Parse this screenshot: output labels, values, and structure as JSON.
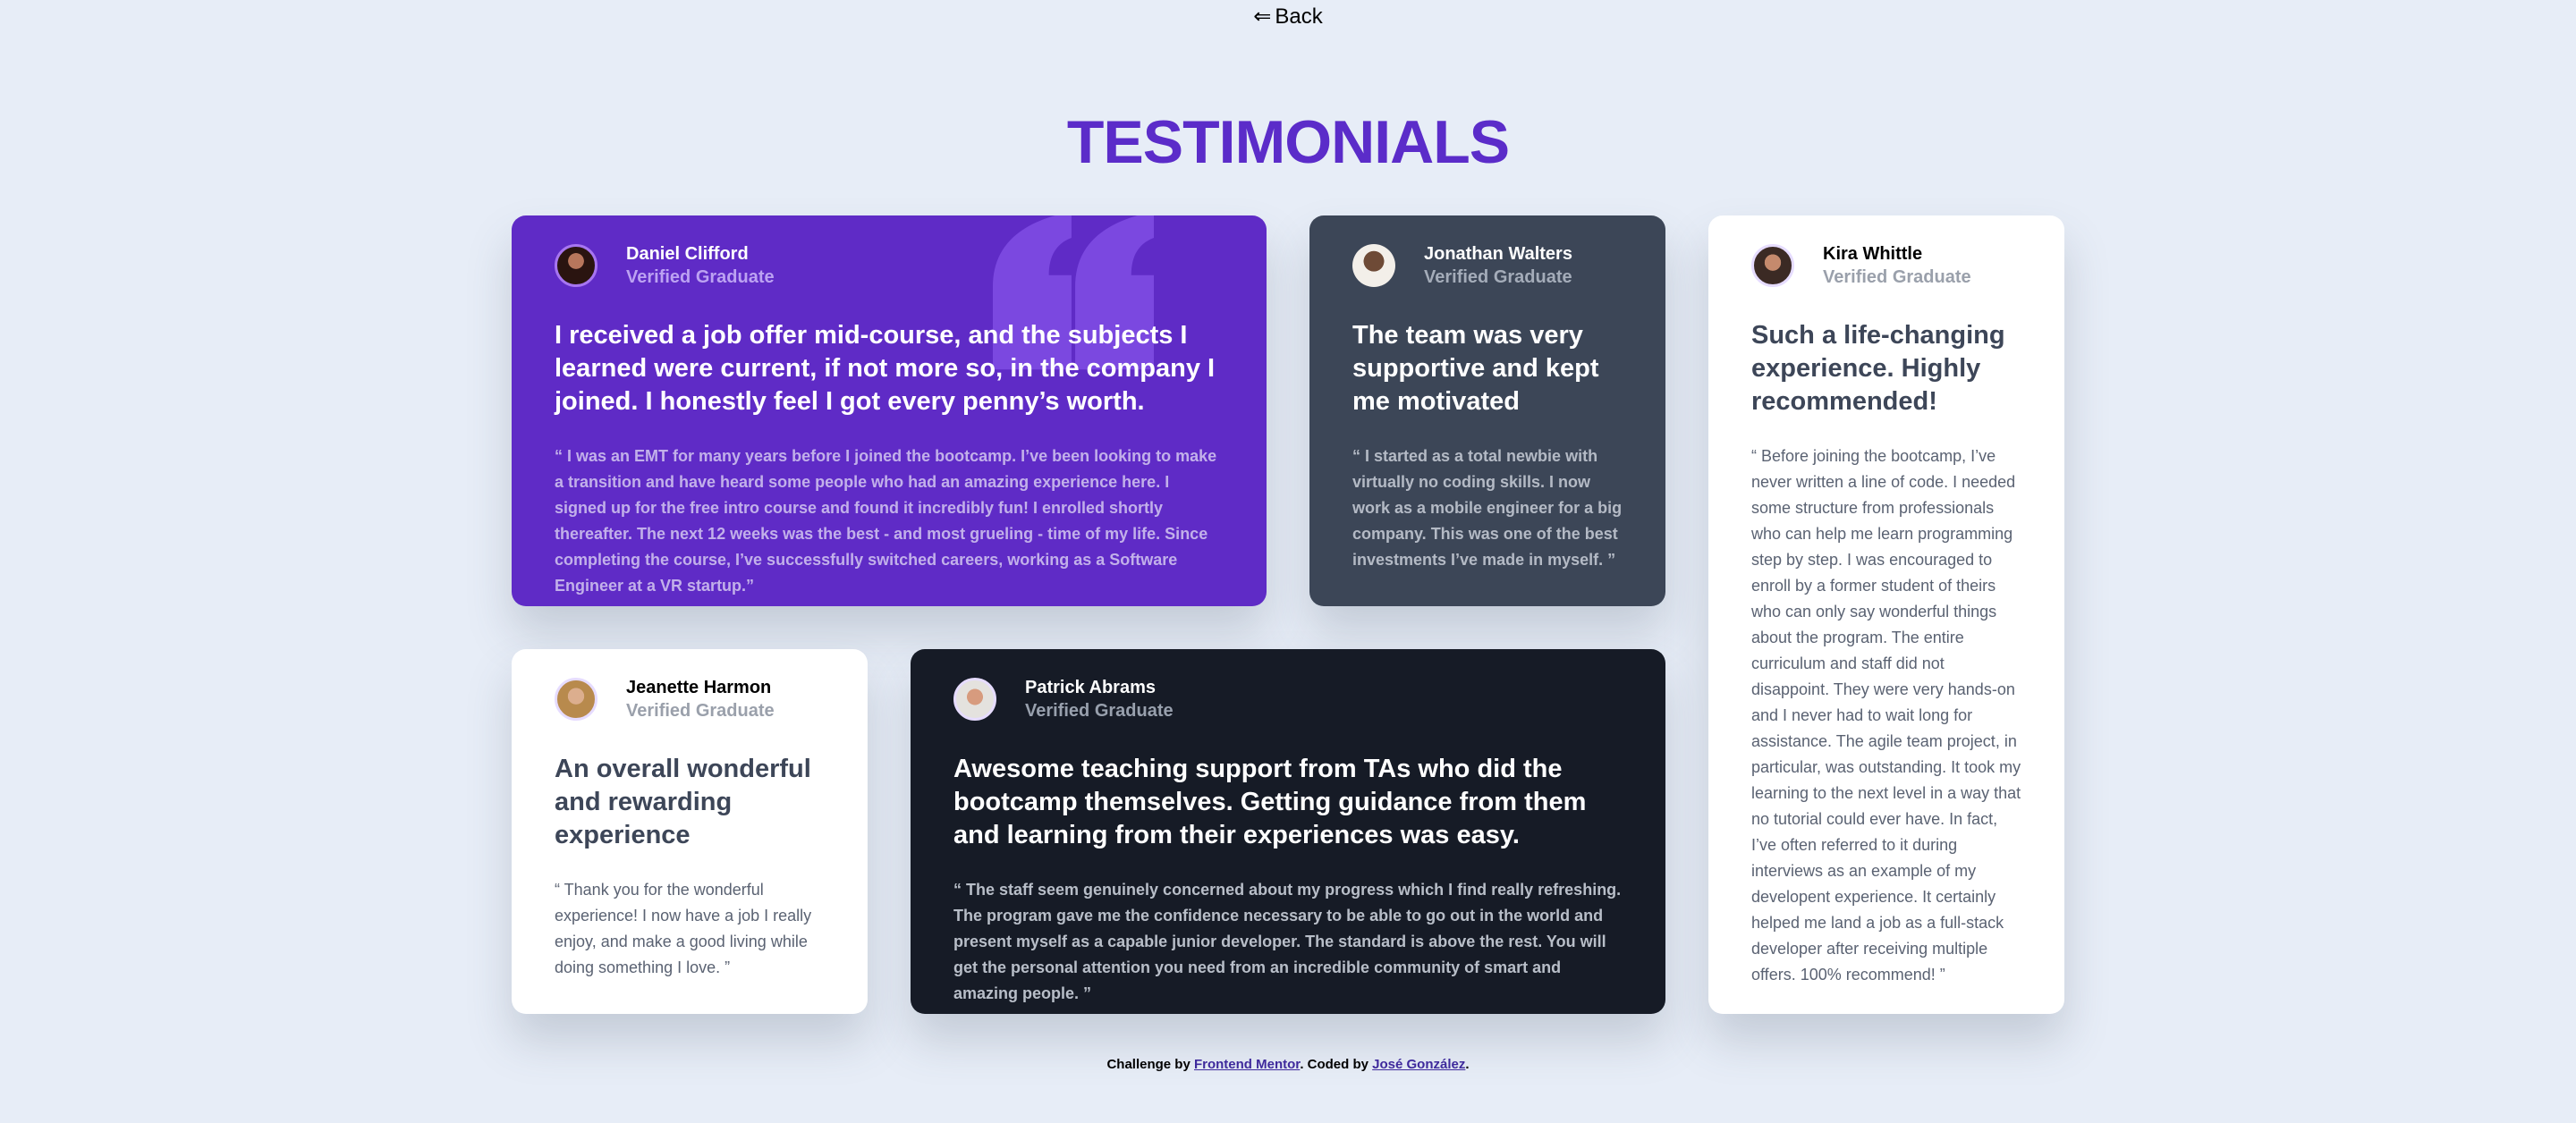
{
  "nav": {
    "back_label": "Back",
    "back_icon": "left-double-arrow-icon"
  },
  "page": {
    "title": "TESTIMONIALS",
    "accent_color": "#5b2cc9",
    "background_color": "#e7edf7"
  },
  "testimonials": [
    {
      "name": "Daniel Clifford",
      "role": "Verified Graduate",
      "headline": "I received a job offer mid-course, and the subjects I learned were current, if not more so, in the company I joined. I honestly feel I got every penny’s worth.",
      "quote": "“ I was an EMT for many years before I joined the bootcamp. I’ve been looking to make a transition and have heard some people who had an amazing experience here. I signed up for the free intro course and found it incredibly fun! I enrolled shortly thereafter. The next 12 weeks was the best - and most grueling - time of my life. Since completing the course, I’ve successfully switched careers, working as a Software Engineer at a VR startup.”",
      "card_color": "#5f2bc6"
    },
    {
      "name": "Jonathan Walters",
      "role": "Verified Graduate",
      "headline": "The team was very supportive and kept me motivated",
      "quote": "“ I started as a total newbie with virtually no coding skills. I now work as a mobile engineer for a big company. This was one of the best investments I’ve made in myself. ”",
      "card_color": "#3c4657"
    },
    {
      "name": "Kira Whittle",
      "role": "Verified Graduate",
      "headline": "Such a life-changing experience. Highly recommended!",
      "quote": "“ Before joining the bootcamp, I’ve never written a line of code. I needed some structure from professionals who can help me learn programming step by step. I was encouraged to enroll by a former student of theirs who can only say wonderful things about the program. The entire curriculum and staff did not disappoint. They were very hands-on and I never had to wait long for assistance. The agile team project, in particular, was outstanding. It took my learning to the next level in a way that no tutorial could ever have. In fact, I’ve often referred to it during interviews as an example of my developent experience. It certainly helped me land a job as a full-stack developer after receiving multiple offers. 100% recommend! ”",
      "card_color": "#ffffff"
    },
    {
      "name": "Jeanette Harmon",
      "role": "Verified Graduate",
      "headline": "An overall wonderful and rewarding experience",
      "quote": "“ Thank you for the wonderful experience! I now have a job I really enjoy, and make a good living while doing something I love. ”",
      "card_color": "#ffffff"
    },
    {
      "name": "Patrick Abrams",
      "role": "Verified Graduate",
      "headline": "Awesome teaching support from TAs who did the bootcamp themselves. Getting guidance from them and learning from their experiences was easy.",
      "quote": "“ The staff seem genuinely concerned about my progress which I find really refreshing. The program gave me the confidence necessary to be able to go out in the world and present myself as a capable junior developer. The standard is above the rest. You will get the personal attention you need from an incredible community of smart and amazing people. ”",
      "card_color": "#161b26"
    }
  ],
  "footer": {
    "prefix": "Challenge by",
    "challenge_link": "Frontend Mentor",
    "middle": ". Coded by",
    "author_link": "José González",
    "suffix": "."
  }
}
